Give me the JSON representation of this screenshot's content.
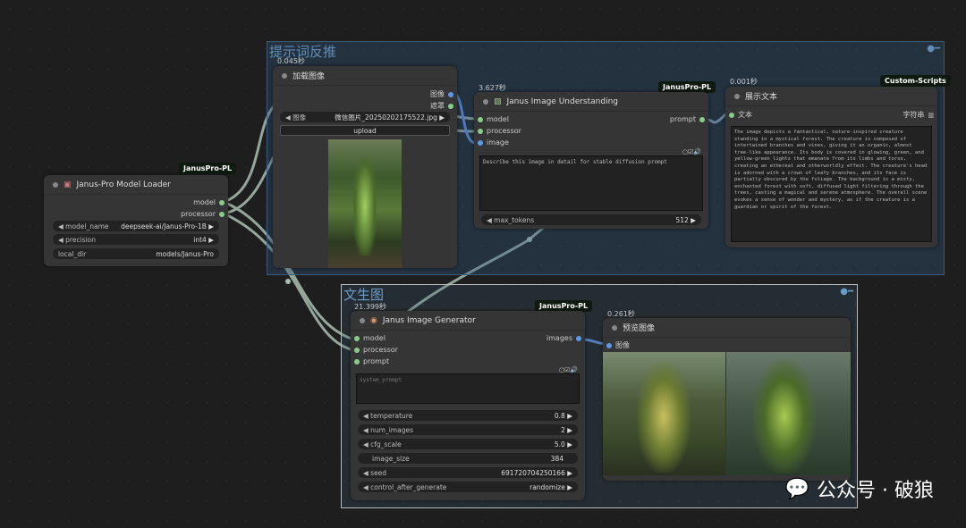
{
  "groups": {
    "reverse": {
      "title": "提示词反推",
      "color": "#3a5a7a"
    },
    "t2i": {
      "title": "文生图",
      "color": "#bbbbbb"
    }
  },
  "loader": {
    "badge": "JanusPro-PL",
    "title": "Janus-Pro Model Loader",
    "out_model": "model",
    "out_processor": "processor",
    "widgets": [
      {
        "label": "model_name",
        "value": "deepseek-ai/Janus-Pro-1B"
      },
      {
        "label": "precision",
        "value": "int4"
      },
      {
        "label": "local_dir",
        "value": "models/Janus-Pro"
      }
    ]
  },
  "load_image": {
    "time": "0.045秒",
    "title": "加载图像",
    "out_image": "图像",
    "out_mask": "遮罩",
    "file_label": "图像",
    "file_value": "微信图片_20250202175522.jpg",
    "upload": "upload"
  },
  "understanding": {
    "time": "3.627秒",
    "badge": "JanusPro-PL",
    "title": "Janus Image Understanding",
    "in_model": "model",
    "in_processor": "processor",
    "in_image": "image",
    "out_prompt": "prompt",
    "question": "Describe this image in detail for stable diffusion prompt",
    "max_tokens_label": "max_tokens",
    "max_tokens_value": "512"
  },
  "show_text": {
    "time": "0.001秒",
    "badge": "Custom-Scripts",
    "title": "展示文本",
    "in_text": "文本",
    "out_string": "字符串",
    "text": "The image depicts a fantastical, nature-inspired creature standing in a mystical forest. The creature is composed of intertwined branches and vines, giving it an organic, almost tree-like appearance. Its body is covered in glowing, green, and yellow-green lights that emanate from its limbs and torso, creating an ethereal and otherworldly effect. The creature's head is adorned with a crown of leafy branches, and its face is partially obscured by the foliage. The background is a misty, enchanted forest with soft, diffused light filtering through the trees, casting a magical and serene atmosphere. The overall scene evokes a sense of wonder and mystery, as if the creature is a guardian or spirit of the forest."
  },
  "generator": {
    "time": "21.399秒",
    "badge": "JanusPro-PL",
    "title": "Janus Image Generator",
    "in_model": "model",
    "in_processor": "processor",
    "in_prompt": "prompt",
    "out_images": "images",
    "system_prompt": "system_prompt",
    "widgets": [
      {
        "label": "temperature",
        "value": "0.8"
      },
      {
        "label": "num_images",
        "value": "2"
      },
      {
        "label": "cfg_scale",
        "value": "5.0"
      },
      {
        "label": "image_size",
        "value": "384"
      },
      {
        "label": "seed",
        "value": "691720704250166"
      },
      {
        "label": "control_after_generate",
        "value": "randomize"
      }
    ]
  },
  "preview": {
    "time": "0.261秒",
    "title": "预览图像",
    "in_image": "图像"
  },
  "watermark": {
    "text": "公众号 · 破狼"
  }
}
